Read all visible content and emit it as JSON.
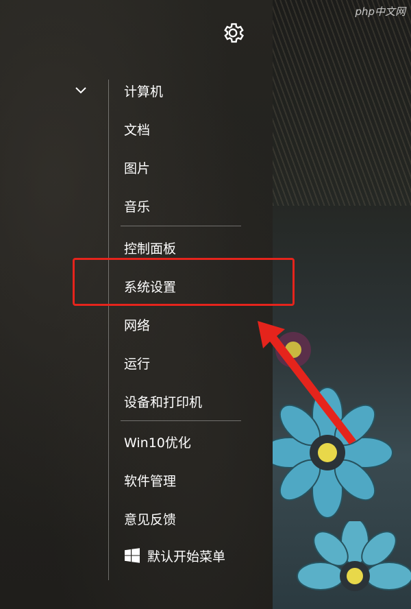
{
  "watermark": "php中文网",
  "icons": {
    "settings": "gear-icon",
    "collapse": "chevron-down-icon",
    "windows": "windows-logo-icon"
  },
  "menu": {
    "group1": [
      "计算机",
      "文档",
      "图片",
      "音乐"
    ],
    "group2": [
      "控制面板",
      "系统设置",
      "网络",
      "运行",
      "设备和打印机"
    ],
    "group3": [
      "Win10优化",
      "软件管理",
      "意见反馈"
    ],
    "default_start_menu": "默认开始菜单"
  },
  "highlighted_item": "系统设置",
  "colors": {
    "annotation": "#e5241c",
    "text": "#ffffff"
  }
}
